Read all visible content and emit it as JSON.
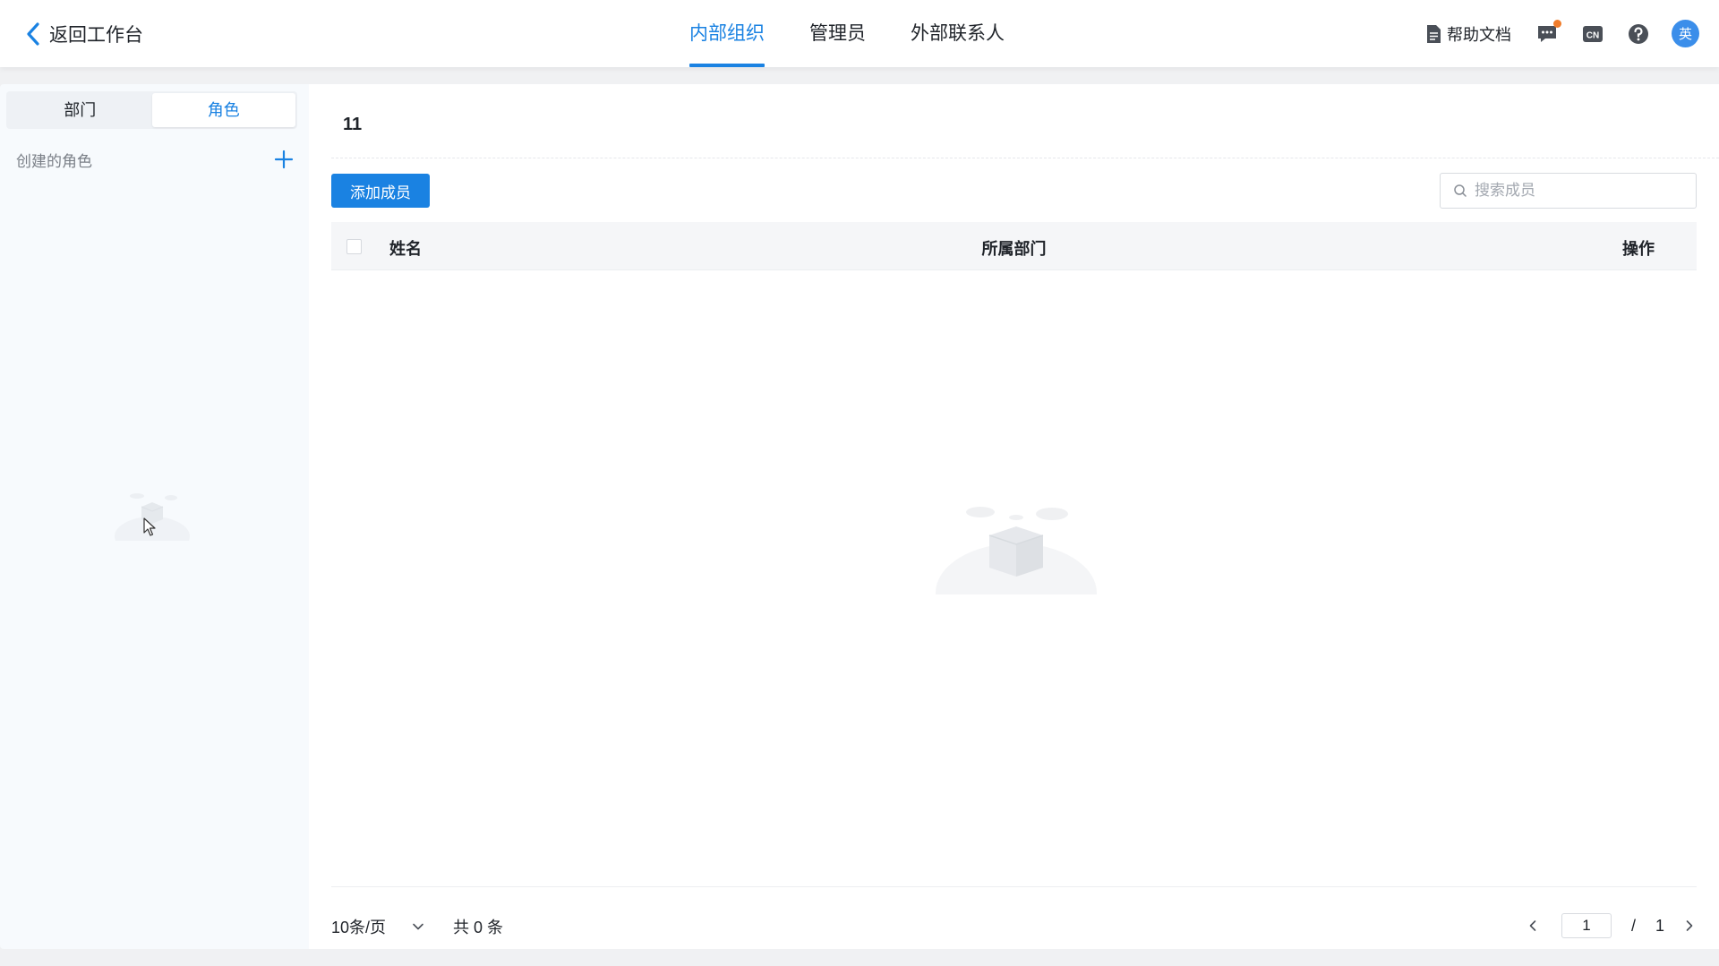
{
  "header": {
    "back_label": "返回工作台",
    "tabs": [
      {
        "label": "内部组织",
        "active": true
      },
      {
        "label": "管理员",
        "active": false
      },
      {
        "label": "外部联系人",
        "active": false
      }
    ],
    "help_label": "帮助文档",
    "lang_icon_text": "CN",
    "avatar_text": "英",
    "accent_color": "#1a82e2",
    "notification_dot_color": "#f07c2a"
  },
  "sidebar": {
    "segments": [
      {
        "label": "部门",
        "active": false
      },
      {
        "label": "角色",
        "active": true
      }
    ],
    "section_label": "创建的角色"
  },
  "main": {
    "title": "11",
    "add_button_label": "添加成员",
    "search_placeholder": "搜索成员",
    "table": {
      "columns": [
        "姓名",
        "所属部门",
        "操作"
      ],
      "rows": []
    },
    "footer": {
      "page_size": "10条/页",
      "total": "共 0 条",
      "current_page": "1",
      "separator": "/",
      "total_pages": "1"
    }
  }
}
